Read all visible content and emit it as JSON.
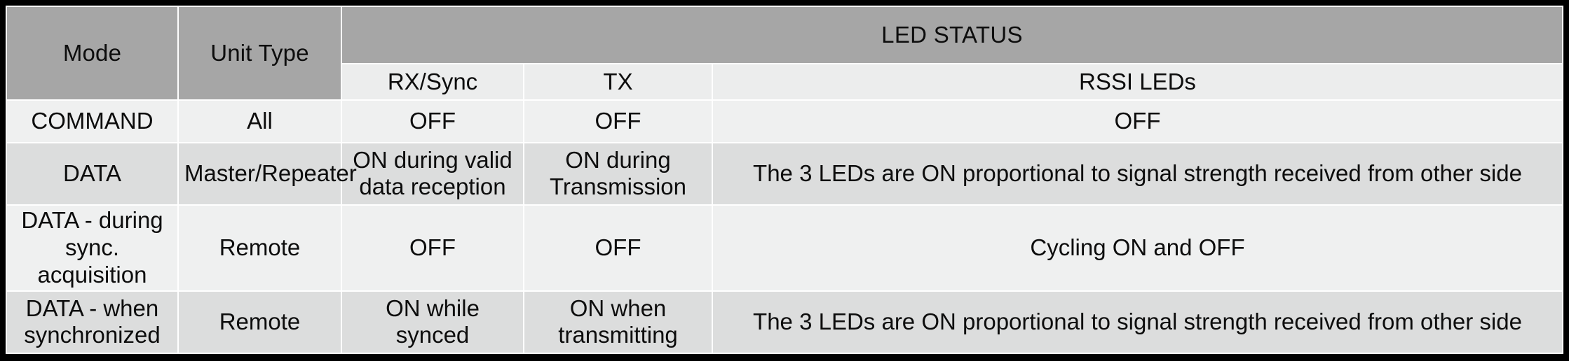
{
  "table": {
    "title": "LED STATUS",
    "group_header": {
      "mode": "Mode",
      "unit_type": "Unit Type",
      "led_status": "LED STATUS"
    },
    "sub_headers": {
      "rx_sync": "RX/Sync",
      "tx": "TX",
      "rssi_leds": "RSSI LEDs"
    },
    "columns": [
      "Mode",
      "Unit Type",
      "RX/Sync",
      "TX",
      "RSSI LEDs"
    ],
    "rows": [
      {
        "mode": "COMMAND",
        "unit_type": "All",
        "rx_sync": "OFF",
        "tx": "OFF",
        "rssi_leds": "OFF"
      },
      {
        "mode": "DATA",
        "unit_type": "Master/Repeater",
        "rx_sync": "ON during valid data reception",
        "tx": "ON during Transmission",
        "rssi_leds": "The 3 LEDs are ON proportional to signal strength received from other side"
      },
      {
        "mode": "DATA - during sync. acquisition",
        "unit_type": "Remote",
        "rx_sync": "OFF",
        "tx": "OFF",
        "rssi_leds": "Cycling ON and OFF"
      },
      {
        "mode": "DATA - when synchronized",
        "unit_type": "Remote",
        "rx_sync": "ON while synced",
        "tx": "ON when transmitting",
        "rssi_leds": "The 3 LEDs are ON proportional to signal strength received from other side"
      }
    ]
  },
  "colors": {
    "header_fill": "#a6a6a6",
    "header_text": "#ffffff",
    "subheader_fill": "#eceded",
    "row_light": "#eff0f0",
    "row_dark": "#dcdddd",
    "body_text": "#0d0d0d",
    "frame": "#000000"
  }
}
